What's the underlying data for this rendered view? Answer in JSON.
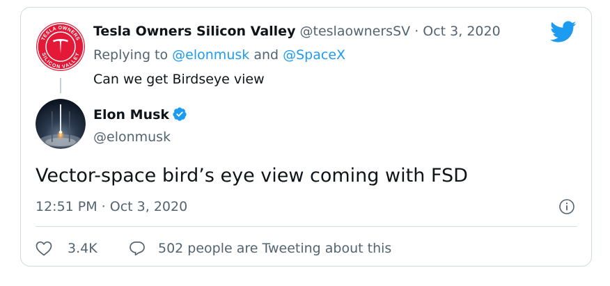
{
  "parent_tweet": {
    "author_name": "Tesla Owners Silicon Valley",
    "author_handle": "@teslaownersSV",
    "separator": "·",
    "date": "Oct 3, 2020",
    "replying_prefix": "Replying to",
    "replying_mention_1": "@elonmusk",
    "replying_and": "and",
    "replying_mention_2": "@SpaceX",
    "text": "Can we get Birdseye view",
    "avatar": {
      "ring_text_top": "TESLA OWNERS",
      "ring_text_bottom": "SILICON VALLEY",
      "color": "#e31937"
    }
  },
  "main_tweet": {
    "author_name": "Elon Musk",
    "author_handle": "@elonmusk",
    "verified": true,
    "text": "Vector-space bird’s eye view coming with FSD",
    "timestamp": "12:51 PM · Oct 3, 2020"
  },
  "actions": {
    "like_count": "3.4K",
    "reply_label": "502 people are Tweeting about this"
  },
  "icons": {
    "brand": "twitter-bird-icon",
    "verified": "verified-badge-icon",
    "info": "info-icon",
    "like": "heart-icon",
    "reply": "comment-bubble-icon"
  },
  "colors": {
    "brand_blue": "#1d9bf0",
    "text_primary": "#0f1419",
    "text_secondary": "#536471",
    "border": "#cfd9de",
    "tesla_red": "#e31937"
  }
}
